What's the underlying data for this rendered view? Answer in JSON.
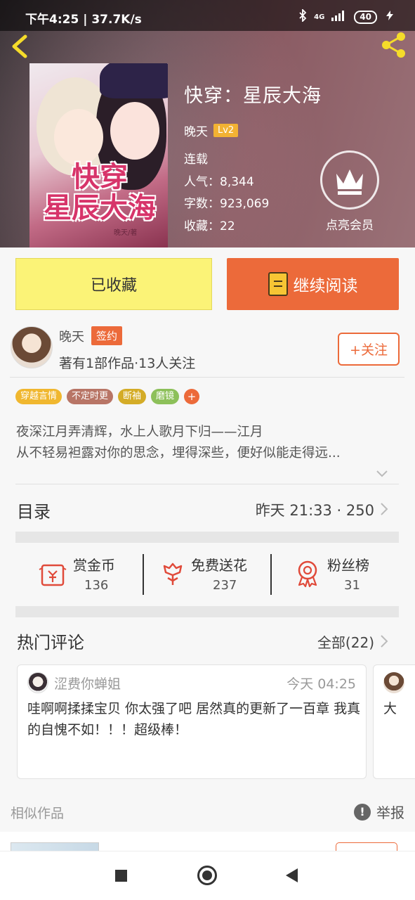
{
  "status_bar": {
    "time": "下午4:25 | 37.7K/s",
    "network": "4G",
    "battery": "40"
  },
  "book": {
    "title": "快穿：星辰大海",
    "author": "晚天",
    "level": "Lv2",
    "status": "连载",
    "popularity": "人气：8,344",
    "word_count": "字数：923,069",
    "collections": "收藏：22",
    "cover_title_line1": "快穿",
    "cover_title_line2": "星辰大海",
    "cover_author": "晚天/著"
  },
  "vip": {
    "label": "点亮会员"
  },
  "actions": {
    "collected_label": "已收藏",
    "continue_label": "继续阅读"
  },
  "author": {
    "name": "晚天",
    "badge": "签约",
    "stats": "著有1部作品·13人关注",
    "follow_label": "+关注"
  },
  "tags": [
    {
      "label": "穿越言情",
      "color": "#f0b72f"
    },
    {
      "label": "不定时更",
      "color": "#b87566"
    },
    {
      "label": "断袖",
      "color": "#d4ac27"
    },
    {
      "label": "磨镜",
      "color": "#8dc05a"
    }
  ],
  "tag_more": "+",
  "description": {
    "line1": "夜深江月弄清辉，水上人歌月下归——江月",
    "line2": "从不轻易袒露对你的思念，埋得深些，便好似能走得远..."
  },
  "catalog": {
    "title": "目录",
    "latest": "昨天 21:33 · 250"
  },
  "rewards": [
    {
      "label": "赏金币",
      "count": "136"
    },
    {
      "label": "免费送花",
      "count": "237"
    },
    {
      "label": "粉丝榜",
      "count": "31"
    }
  ],
  "comments": {
    "title": "热门评论",
    "all": "全部(22)",
    "items": [
      {
        "user": "涩费你蝉姐",
        "time": "今天 04:25",
        "text": "哇啊啊揉揉宝贝 你太强了吧 居然真的更新了一百章 我真的自愧不如！！！超级棒！"
      },
      {
        "text": "大"
      }
    ]
  },
  "similar": {
    "title": "相似作品",
    "report_label": "举报"
  },
  "colors": {
    "accent": "#ec6a3a",
    "collected_bg": "#fbf377",
    "vip_ring": "#ffffff"
  }
}
